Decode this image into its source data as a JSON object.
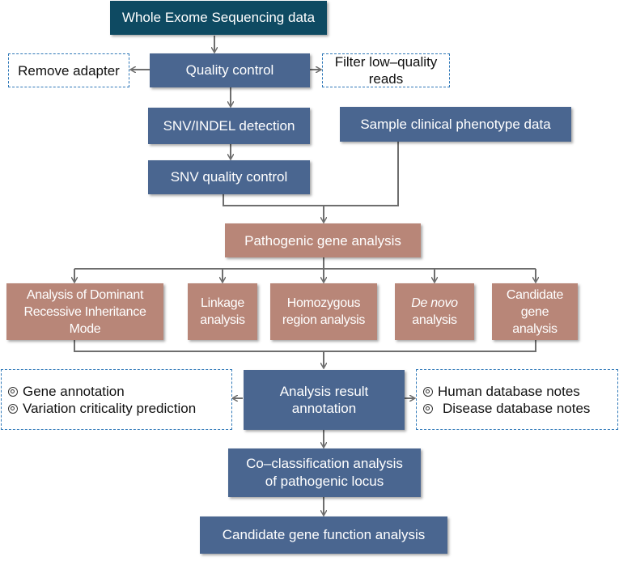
{
  "diagram": {
    "title_node": "Whole Exome Sequencing data",
    "quality_control": "Quality control",
    "remove_adapter": "Remove adapter",
    "filter_reads": "Filter low–quality reads",
    "snv_indel_detection": "SNV/INDEL detection",
    "clinical_phenotype": "Sample clinical phenotype data",
    "snv_quality_control": "SNV quality control",
    "pathogenic_gene_analysis": "Pathogenic gene analysis",
    "analyses": [
      {
        "label": "Analysis of Dominant Recessive Inheritance Mode"
      },
      {
        "label": "Linkage analysis"
      },
      {
        "label": "Homozygous region analysis"
      },
      {
        "label_italic": "De novo",
        "label": "analysis"
      },
      {
        "label": "Candidate gene analysis"
      }
    ],
    "analysis_result_annotation": "Analysis result annotation",
    "left_notes": [
      "Gene annotation",
      "Variation criticality prediction"
    ],
    "right_notes": [
      "Human database notes",
      "Disease database notes"
    ],
    "co_classification": "Co–classification analysis of pathogenic locus",
    "candidate_function": "Candidate gene function analysis"
  },
  "colors": {
    "top_node": "#0e4a62",
    "process_node": "#4a6690",
    "analysis_node": "#b88678",
    "dashed_border": "#2f78b8",
    "connector": "#6e6e6e"
  }
}
